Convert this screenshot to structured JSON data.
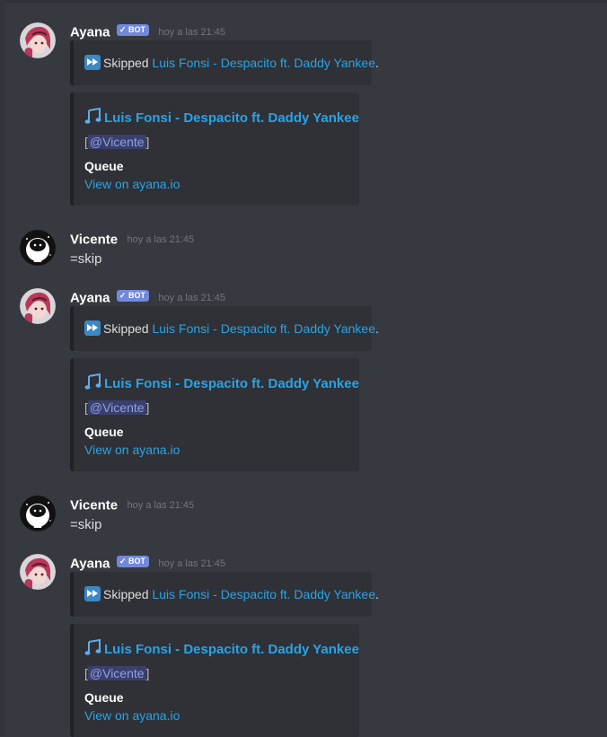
{
  "bot": {
    "author": "Ayana",
    "badge": "✓ BOT",
    "timestamp": "hoy a las 21:45",
    "skipped_prefix": "Skipped",
    "song_link": "Luis Fonsi - Despacito ft. Daddy Yankee",
    "skipped_suffix": ".",
    "now_playing_title": "Luis Fonsi - Despacito ft. Daddy Yankee",
    "requester_open": "[",
    "requester_mention": "@Vicente",
    "requester_close": "]",
    "queue_label": "Queue",
    "queue_link": "View on ayana.io"
  },
  "user": {
    "author": "Vicente",
    "timestamp": "hoy a las 21:45",
    "message": "=skip"
  },
  "colors": {
    "background": "#36393f",
    "embed_bg": "#2f3136",
    "link": "#2aa3e6",
    "badge": "#7289da",
    "mention_bg": "#3a3f6e"
  },
  "icons": {
    "fast_forward": "fast-forward-icon",
    "notes": "musical-notes-icon",
    "bot_avatar": "ayana-avatar",
    "user_avatar": "vicente-avatar"
  }
}
